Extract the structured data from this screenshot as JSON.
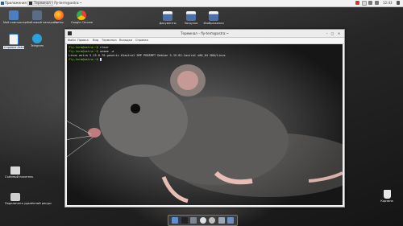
{
  "top_bar": {
    "menu_label": "Приложения",
    "tasks": [
      {
        "label": "Терминал – fly-term@astra:~"
      },
      {
        "label": "Терминал – fly-term@astra:~"
      }
    ],
    "clock": "12:43"
  },
  "desktop_icons_left": [
    {
      "label": "Мой компьютер",
      "color": "#4d7fc0"
    },
    {
      "label": "Файловый менеджер",
      "color": "#5b6b8a"
    },
    {
      "label": "Firefox",
      "color": "#ff7a18"
    },
    {
      "label": "Google Chrome",
      "color": "#e94235"
    },
    {
      "label": "Справка Astra",
      "color": "#3a7bd5"
    },
    {
      "label": "Telegram",
      "color": "#2aa1da"
    }
  ],
  "desktop_icons_top": [
    {
      "label": "Документы",
      "color": "#4b6fa6"
    },
    {
      "label": "Загрузки",
      "color": "#4b6fa6"
    },
    {
      "label": "Изображения",
      "color": "#4b6fa6"
    }
  ],
  "desktop_icons_bottom_left": [
    {
      "label": "Съёмный носитель",
      "color": "#d9d9d9"
    },
    {
      "label": "Подключить удалённый ресурс",
      "color": "#cfcfcf"
    }
  ],
  "desktop_icon_bottom_right": {
    "label": "Корзина",
    "color": "#e0e0e0"
  },
  "terminal": {
    "title": "Терминал – fly-term@astra:~",
    "menu": [
      "Файл",
      "Правка",
      "Вид",
      "Терминал",
      "Вкладки",
      "Справка"
    ],
    "lines": [
      {
        "prompt": "fly-term@astra:~$",
        "command": " clear"
      },
      {
        "prompt": "fly-term@astra:~$",
        "command": " uname -a"
      },
      {
        "prompt": "",
        "command": "Linux astra 5.15.0-70-generic #1astra1 SMP PREEMPT Debian 5.15.82-1astra1 x86_64 GNU/Linux"
      },
      {
        "prompt": "fly-term@astra:~$",
        "command": ""
      }
    ]
  },
  "dock": {
    "items": [
      {
        "icon": "folder-icon",
        "color": "#5a8fd8"
      },
      {
        "icon": "terminal-icon",
        "color": "#222222"
      },
      {
        "icon": "file-manager-icon",
        "color": "#7b8794"
      },
      {
        "icon": "browser-icon",
        "color": "#e0e0e0"
      },
      {
        "icon": "search-icon",
        "color": "#bfbfbf"
      },
      {
        "icon": "settings-icon",
        "color": "#9aa7b8"
      },
      {
        "icon": "display-icon",
        "color": "#6d8fc5"
      }
    ]
  }
}
